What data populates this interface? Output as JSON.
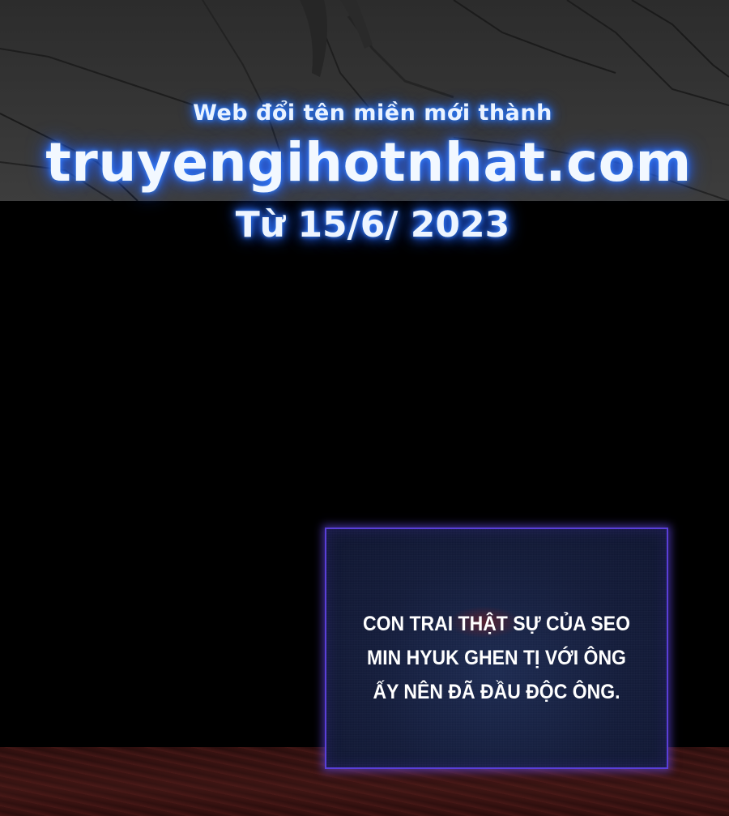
{
  "watermark": {
    "line1": "Web đổi tên miền mới thành",
    "domain": "truyengihotnhat.com",
    "date": "Từ 15/6/ 2023",
    "glow_color": "#2a6fff"
  },
  "narration": {
    "lines": [
      "CON TRAI THẬT SỰ CỦA SEO",
      "MIN HYUK GHEN TỊ VỚI ÔNG",
      "ẤY NÊN ĐÃ ĐẦU ĐỘC ÔNG."
    ],
    "border_color": "#5a3fd8",
    "box_color": "#121b3a"
  }
}
